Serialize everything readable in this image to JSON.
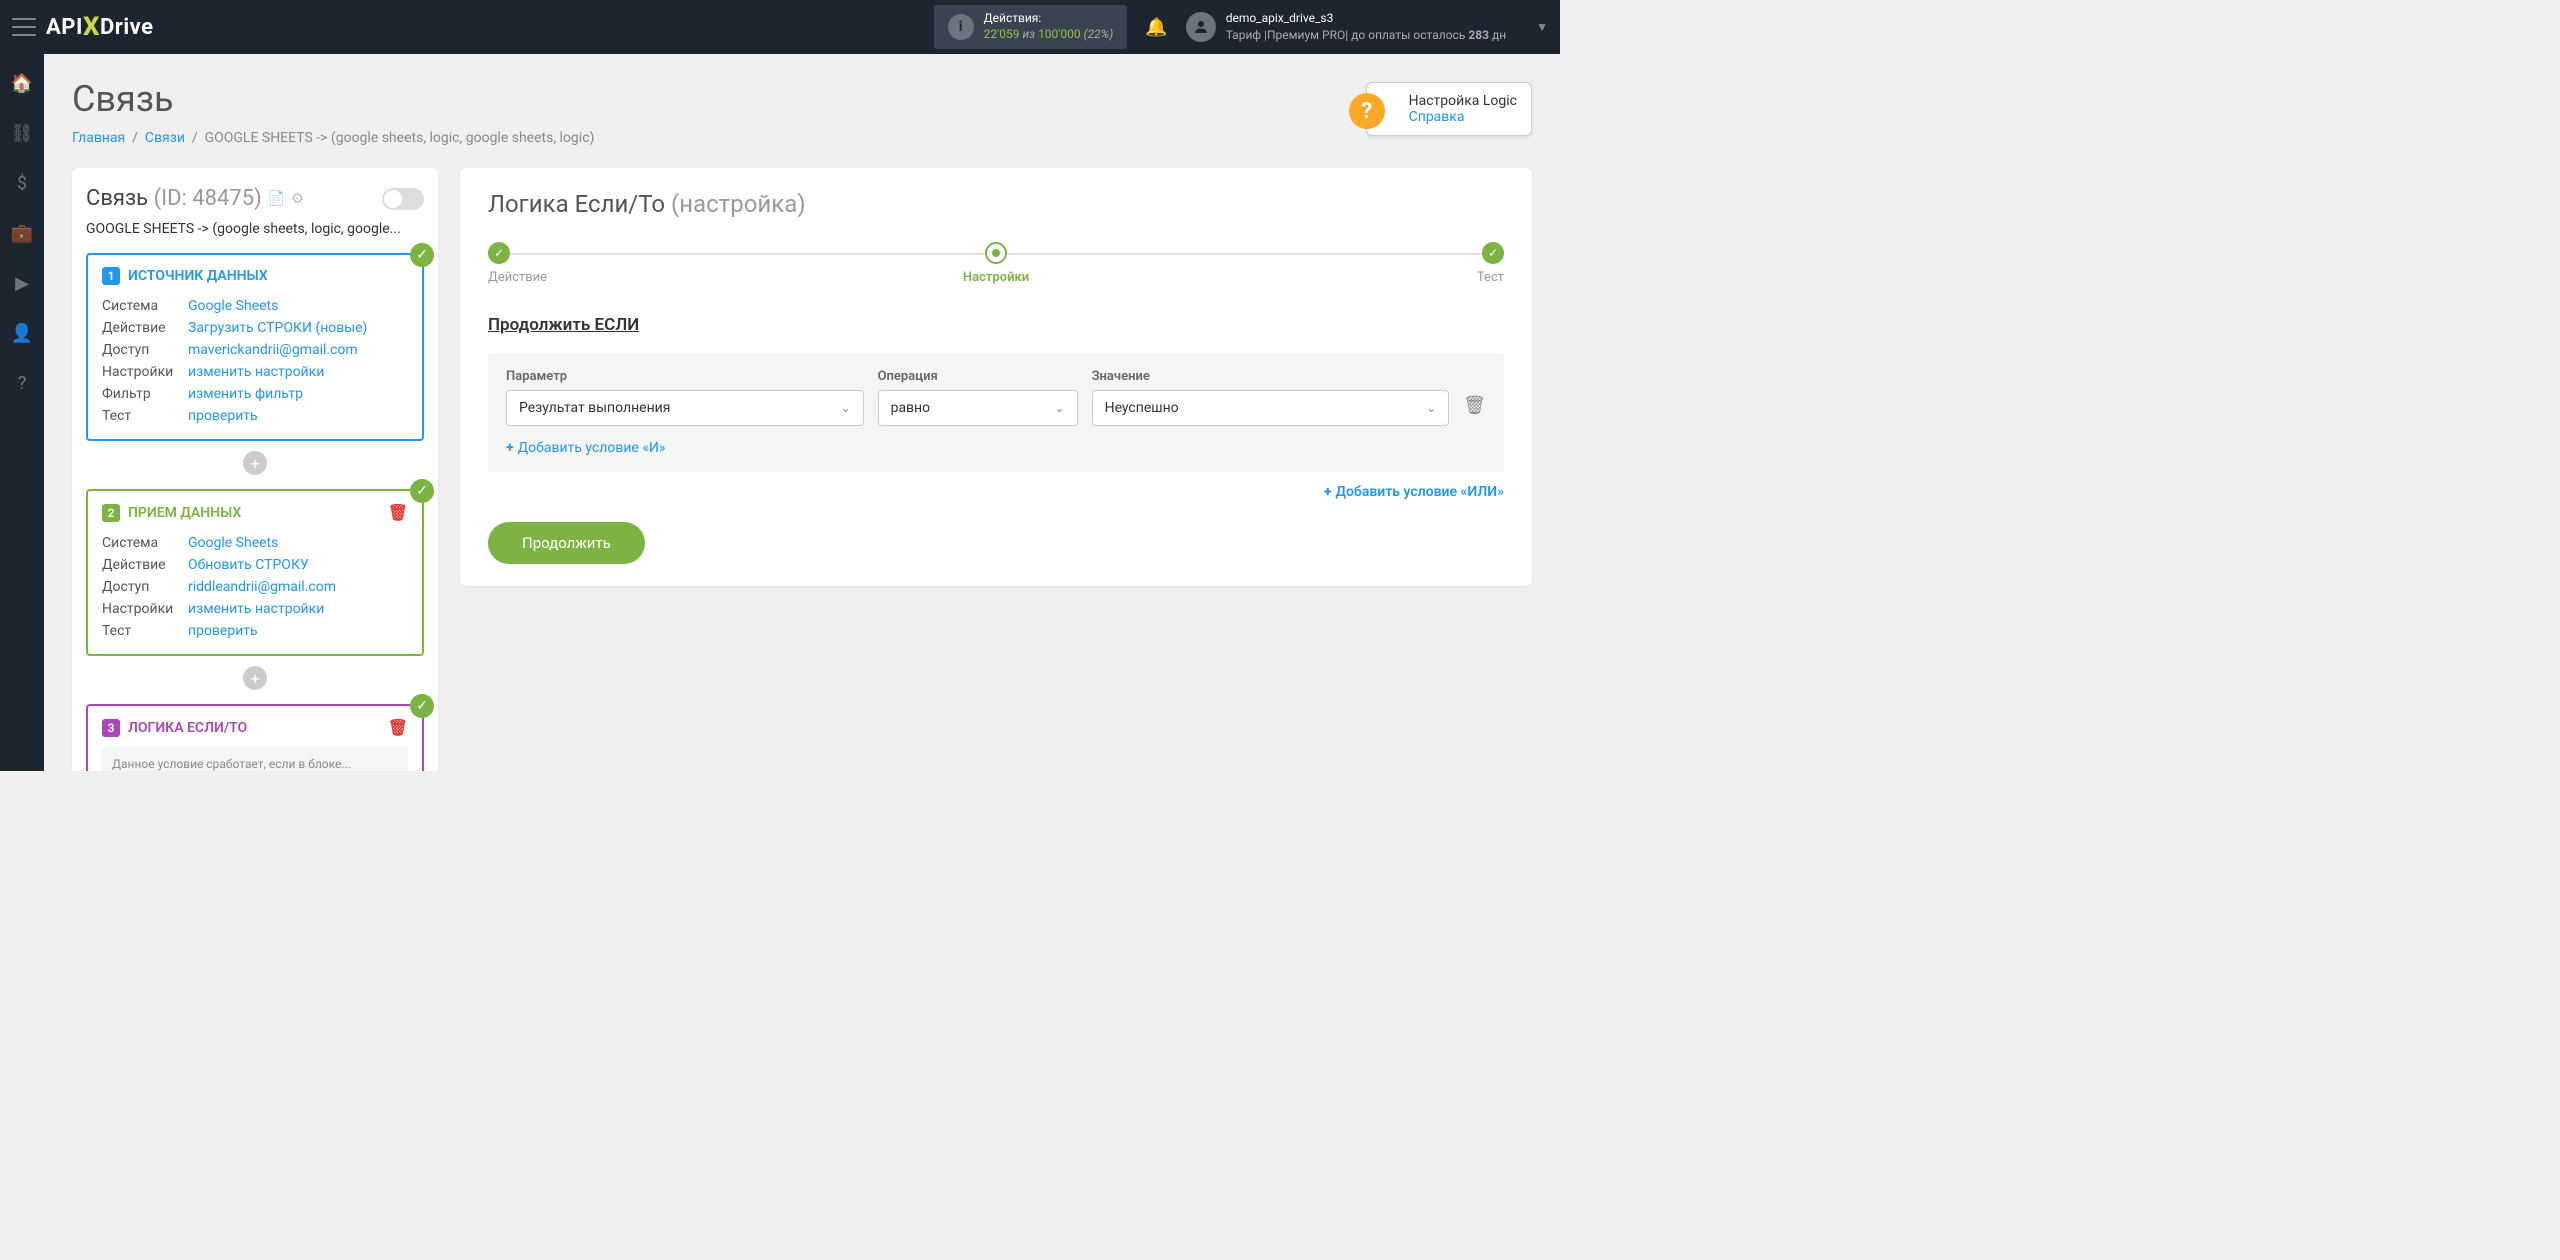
{
  "topbar": {
    "logo_pre": "API",
    "logo_x": "X",
    "logo_post": "Drive",
    "actions_label": "Действия:",
    "actions_used": "22'059",
    "actions_of": "из",
    "actions_limit": "100'000",
    "actions_pct": "(22%)",
    "username": "demo_apix_drive_s3",
    "tariff_line_pre": "Тариф |Премиум PRO| до оплаты осталось ",
    "tariff_days": "283",
    "tariff_line_post": " дн"
  },
  "page": {
    "title": "Связь",
    "crumb_home": "Главная",
    "crumb_links": "Связи",
    "crumb_current": "GOOGLE SHEETS -> (google sheets, logic, google sheets, logic)"
  },
  "help": {
    "title": "Настройка Logic",
    "link": "Справка"
  },
  "conn": {
    "heading": "Связь",
    "id": "(ID: 48475)",
    "subtitle": "GOOGLE SHEETS -> (google sheets, logic, google..."
  },
  "blocks": [
    {
      "num": "1",
      "title": "ИСТОЧНИК ДАННЫХ",
      "rows": [
        {
          "k": "Система",
          "v": "Google Sheets"
        },
        {
          "k": "Действие",
          "v": "Загрузить СТРОКИ (новые)"
        },
        {
          "k": "Доступ",
          "v": "maverickandrii@gmail.com"
        },
        {
          "k": "Настройки",
          "v": "изменить настройки"
        },
        {
          "k": "Фильтр",
          "v": "изменить фильтр"
        },
        {
          "k": "Тест",
          "v": "проверить"
        }
      ]
    },
    {
      "num": "2",
      "title": "ПРИЕМ ДАННЫХ",
      "rows": [
        {
          "k": "Система",
          "v": "Google Sheets"
        },
        {
          "k": "Действие",
          "v": "Обновить СТРОКУ"
        },
        {
          "k": "Доступ",
          "v": "riddleandrii@gmail.com"
        },
        {
          "k": "Настройки",
          "v": "изменить настройки"
        },
        {
          "k": "Тест",
          "v": "проверить"
        }
      ]
    },
    {
      "num": "3",
      "title": "ЛОГИКА ЕСЛИ/ТО",
      "note": "Данное условие сработает, если в блоке..."
    }
  ],
  "right": {
    "title": "Логика Если/То",
    "subtitle": "(настройка)",
    "steps": [
      "Действие",
      "Настройки",
      "Тест"
    ],
    "section": "Продолжить ЕСЛИ",
    "col_param": "Параметр",
    "col_op": "Операция",
    "col_val": "Значение",
    "val_param": "Результат выполнения",
    "val_op": "равно",
    "val_val": "Неуспешно",
    "add_and": "Добавить условие «И»",
    "add_or": "Добавить условие «ИЛИ»",
    "continue": "Продолжить"
  }
}
